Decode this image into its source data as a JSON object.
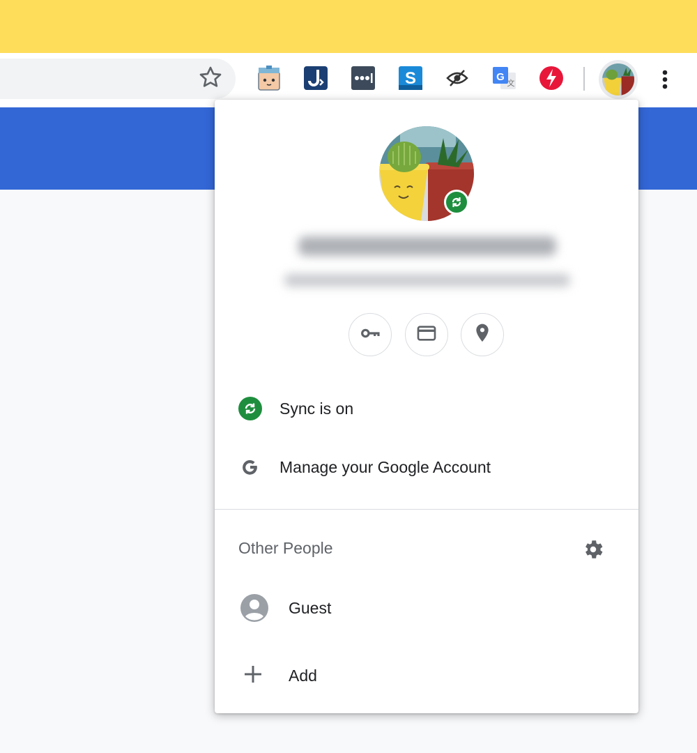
{
  "theme": {
    "top_strip": "#fedd5b",
    "page_header_blue": "#3367d6",
    "sync_green": "#1e8e3e"
  },
  "toolbar": {
    "bookmark_icon": "star-icon",
    "extensions": [
      {
        "name": "tofu-extension-icon"
      },
      {
        "name": "jumpy-extension-icon"
      },
      {
        "name": "lastpass-extension-icon"
      },
      {
        "name": "s-extension-icon"
      },
      {
        "name": "hide-eye-extension-icon"
      },
      {
        "name": "google-translate-extension-icon"
      },
      {
        "name": "bolt-extension-icon"
      }
    ],
    "menu_icon": "three-dots-vertical-icon"
  },
  "profile_menu": {
    "quick_actions": [
      {
        "name": "passwords-button",
        "icon": "key-icon"
      },
      {
        "name": "payment-methods-button",
        "icon": "credit-card-icon"
      },
      {
        "name": "addresses-button",
        "icon": "location-pin-icon"
      }
    ],
    "sync_label": "Sync is on",
    "manage_account_label": "Manage your Google Account",
    "other_people_title": "Other People",
    "guest_label": "Guest",
    "add_label": "Add"
  }
}
